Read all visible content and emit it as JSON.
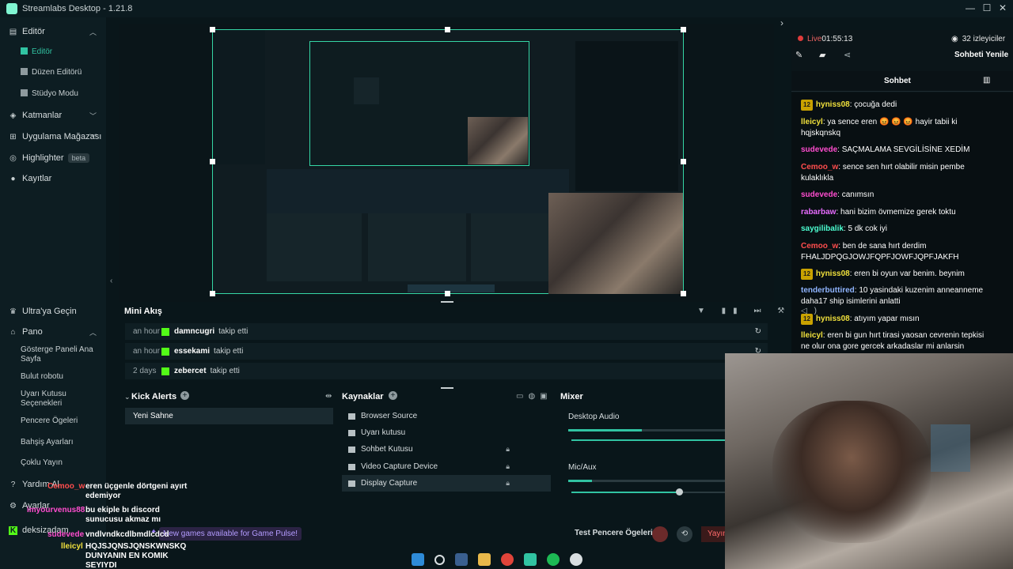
{
  "window": {
    "title": "Streamlabs Desktop - 1.21.8",
    "minimize": "—",
    "maximize": "☐",
    "close": "✕"
  },
  "sidebar": {
    "editor": "Editör",
    "editor_sub": [
      "Editör",
      "Düzen Editörü",
      "Stüdyo Modu"
    ],
    "layers": "Katmanlar",
    "app_store": "Uygulama Mağazası",
    "highlighter": "Highlighter",
    "beta": "beta",
    "recordings": "Kayıtlar",
    "ultra": "Ultra'ya Geçin",
    "dashboard": "Pano",
    "dashboard_sub": [
      "Gösterge Paneli Ana Sayfa",
      "Bulut robotu",
      "Uyarı Kutusu Seçenekleri",
      "Pencere Ögeleri",
      "Bahşiş Ayarları",
      "Çoklu Yayın"
    ],
    "help": "Yardım Al",
    "settings": "Ayarlar",
    "user": "deksizadam"
  },
  "chat": {
    "live_label": "Live",
    "live_time": "01:55:13",
    "viewers": "32 izleyiciler",
    "refresh_chat": "Sohbeti Yenile",
    "title": "Sohbet",
    "messages": [
      {
        "badge": "12",
        "user": "hyniss08",
        "color": "#f0e03c",
        "text": "çocuğa dedi"
      },
      {
        "badge": "",
        "user": "lleicyl",
        "color": "#f0e03c",
        "text": "ya sence eren 😡 😡 😡 hayir tabii ki hqjskqnskq"
      },
      {
        "badge": "",
        "user": "sudevede",
        "color": "#ff4dcf",
        "text": "SAÇMALAMA SEVGİLİSİNE XEDİM"
      },
      {
        "badge": "",
        "user": "Cemoo_w",
        "color": "#ff4d4d",
        "text": "sence sen hırt olabilir misin pembe kulaklıkla"
      },
      {
        "badge": "",
        "user": "sudevede",
        "color": "#ff4dcf",
        "text": "canımsın"
      },
      {
        "badge": "",
        "user": "rabarbaw",
        "color": "#e86cff",
        "text": "hani bizim övmemize gerek toktu"
      },
      {
        "badge": "",
        "user": "saygilibalik",
        "color": "#4dffd2",
        "text": "5 dk cok iyi"
      },
      {
        "badge": "",
        "user": "Cemoo_w",
        "color": "#ff4d4d",
        "text": "ben de sana hırt derdim FHALJDPQGJOWJFQPFJOWFJQPFJAKFH"
      },
      {
        "badge": "12",
        "user": "hyniss08",
        "color": "#f0e03c",
        "text": "eren bi oyun var benim. beynim yetmedi"
      },
      {
        "badge": "",
        "user": "tenderbuttired",
        "color": "#8fb4ff",
        "text": "10 yasindaki kuzenim anneanneme daha17 ship isimlerini anlatti"
      },
      {
        "badge": "12",
        "user": "hyniss08",
        "color": "#f0e03c",
        "text": "atıyım yapar mısın"
      },
      {
        "badge": "",
        "user": "lleicyl",
        "color": "#f0e03c",
        "text": "eren bi gun hırt tirasi yaosan cevrenin tepkisi ne olur ona gore gercek arkadaslar mi anlarsin cunku"
      }
    ]
  },
  "mini_feed": {
    "title": "Mini Akış",
    "rows": [
      {
        "time": "an hour",
        "user": "damncugri",
        "action": "takip etti"
      },
      {
        "time": "an hour",
        "user": "essekami",
        "action": "takip etti"
      },
      {
        "time": "2 days",
        "user": "zebercet",
        "action": "takip etti"
      }
    ]
  },
  "scenes": {
    "title": "Kick Alerts",
    "items": [
      "Yeni Sahne"
    ]
  },
  "sources": {
    "title": "Kaynaklar",
    "items": [
      {
        "name": "Browser Source",
        "locked": false
      },
      {
        "name": "Uyarı kutusu",
        "locked": false
      },
      {
        "name": "Sohbet Kutusu",
        "locked": true
      },
      {
        "name": "Video Capture Device",
        "locked": true
      },
      {
        "name": "Display Capture",
        "locked": true
      }
    ]
  },
  "mixer": {
    "title": "Mixer",
    "channels": [
      {
        "name": "Desktop Audio",
        "level": 0.47,
        "volume": 1.0
      },
      {
        "name": "Mic/Aux",
        "level": 0.15,
        "volume": 0.7
      }
    ]
  },
  "footer": {
    "notification": "New games available for Game Pulse!",
    "test_widgets": "Test Pencere Ögeleri",
    "go_live": "Yayına"
  },
  "overlay_chat": [
    {
      "user": "Cemoo_w",
      "color": "#ff4d4d",
      "text": "eren üçgenle dörtgeni ayırt edemiyor"
    },
    {
      "user": "imyourvenus88",
      "color": "#ff4dcf",
      "text": "bu ekiple bı discord sunucusu akmaz mı"
    },
    {
      "user": "sudevede",
      "color": "#ff4dcf",
      "text": "vndlvndkcdlbmdlcdcd"
    },
    {
      "user": "lleicyl",
      "color": "#f0e03c",
      "text": "HQJSJQNSJQNSKWNSKQ DUNYANIN EN KOMIK SEYIYDI"
    }
  ],
  "colors": {
    "accent": "#31c3a2",
    "kick_green": "#53fc18",
    "live_red": "#e03b3b"
  }
}
